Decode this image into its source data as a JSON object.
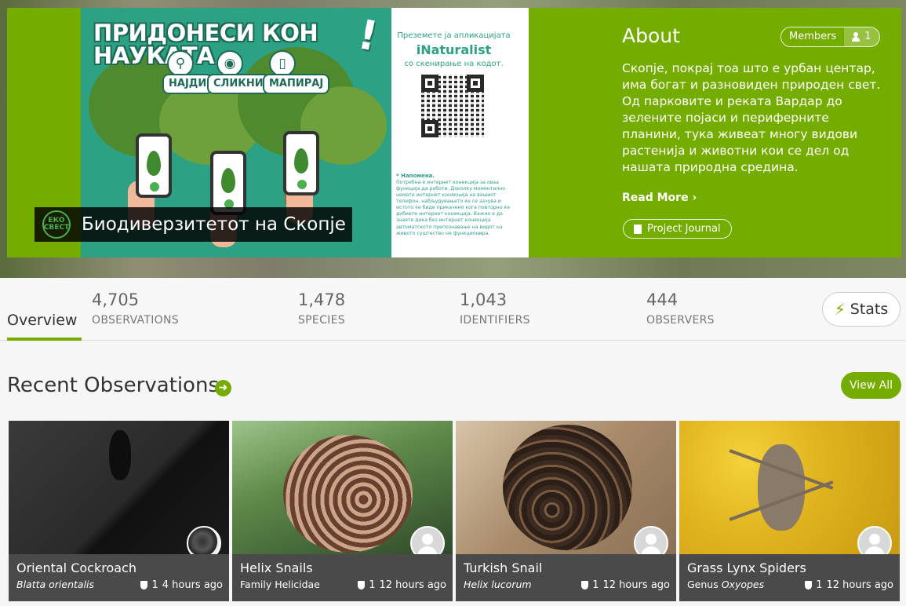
{
  "banner": {
    "headline": "ПРИДОНЕСИ КОН НАУКАТА",
    "exclamation": "!",
    "steps": [
      {
        "icon": "search-icon",
        "label": "НАЈДИ"
      },
      {
        "icon": "camera-icon",
        "label": "СЛИКНИ"
      },
      {
        "icon": "phone-icon",
        "label": "МАПИРАЈ"
      }
    ],
    "qr_text_top": "Преземете ја апликацијата",
    "qr_brand": "iNaturalist",
    "qr_text_bottom": "со скенирање на кодот.",
    "note_title": "* Напомена.",
    "note_body": "Потребна е интернет конекција за оваа функција да работи. Доколку моментално немате интернет конекција на вашиот телефон, набљудувањето ќе се зачува и истото ќе биде прикачено кога повторно ќе добиете интернет конекција. Важно е да знаете дека без интернет конекција автоматското препознавање на видот на живото суштество не функционира.",
    "logo_text": "ЕКО СВЕСТ",
    "project_title": "Биодиверзитетот на Скопје"
  },
  "about": {
    "title": "About",
    "members_label": "Members",
    "members_count": "1",
    "body": "Скопје, покрај тоа што е урбан центар, има богат и разновиден природен свет. Од парковите и реката Вардар до зелените појаси и периферните планини, тука живеат многу видови растенија и животни кои се дел од нашата природна средина.",
    "read_more": "Read More ›",
    "journal_button": "Project Journal"
  },
  "stats": {
    "overview_tab": "Overview",
    "items": [
      {
        "value": "4,705",
        "label": "OBSERVATIONS"
      },
      {
        "value": "1,478",
        "label": "SPECIES"
      },
      {
        "value": "1,043",
        "label": "IDENTIFIERS"
      },
      {
        "value": "444",
        "label": "OBSERVERS"
      }
    ],
    "stats_button": "Stats"
  },
  "recent": {
    "title": "Recent Observations",
    "view_all": "View All",
    "cards": [
      {
        "name": "Oriental Cockroach",
        "sci_prefix": "",
        "sci": "Blatta orientalis",
        "ids": "1",
        "time": "4 hours ago",
        "avatar": "photo"
      },
      {
        "name": "Helix Snails",
        "sci_prefix": "Family Helicidae",
        "sci": "",
        "ids": "1",
        "time": "12 hours ago",
        "avatar": "default"
      },
      {
        "name": "Turkish Snail",
        "sci_prefix": "",
        "sci": "Helix lucorum",
        "ids": "1",
        "time": "12 hours ago",
        "avatar": "default"
      },
      {
        "name": "Grass Lynx Spiders",
        "sci_prefix": "Genus ",
        "sci": "Oxyopes",
        "ids": "1",
        "time": "12 hours ago",
        "avatar": "default"
      }
    ]
  },
  "colors": {
    "accent": "#74ac00",
    "banner_teal": "#2ca184"
  }
}
